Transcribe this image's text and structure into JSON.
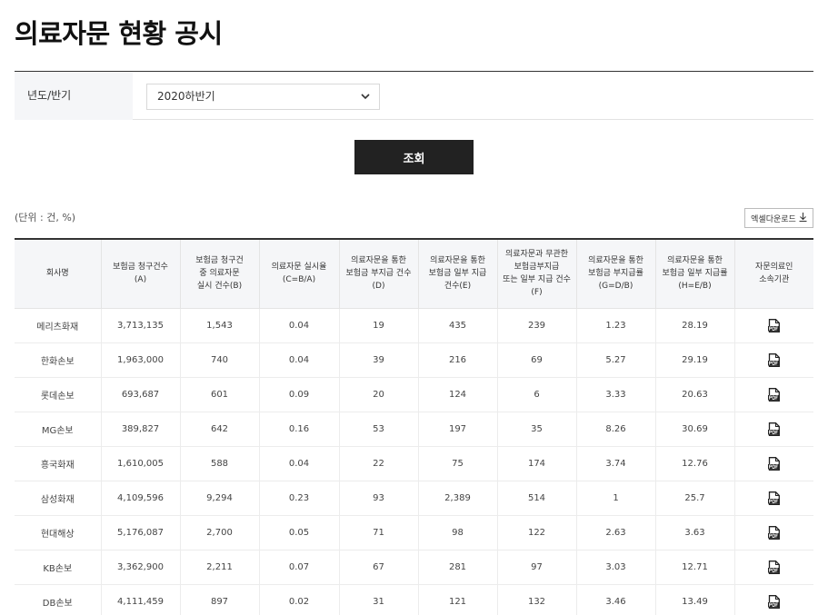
{
  "page": {
    "title": "의료자문 현황 공시"
  },
  "filter": {
    "label": "년도/반기",
    "selected": "2020하반기"
  },
  "search_label": "조회",
  "unit_text": "(단위 : 건, %)",
  "excel_label": "엑셀다운로드",
  "table": {
    "headers": [
      "회사명",
      "보험금 청구건수\n(A)",
      "보험금 청구건\n중 의료자문\n실시 건수(B)",
      "의료자문 실시율\n(C=B/A)",
      "의료자문을 통한\n보험금 부지급 건수\n(D)",
      "의료자문을 통한\n보험금 일부 지급\n건수(E)",
      "의료자문과 무관한\n보험금부지급\n또는 일부 지급 건수\n(F)",
      "의료자문을 통한\n보험금 부지급률\n(G=D/B)",
      "의료자문을 통한\n보험금 일부 지급률\n(H=E/B)",
      "자문의료인\n소속기관"
    ],
    "rows": [
      [
        "메리츠화재",
        "3,713,135",
        "1,543",
        "0.04",
        "19",
        "435",
        "239",
        "1.23",
        "28.19"
      ],
      [
        "한화손보",
        "1,963,000",
        "740",
        "0.04",
        "39",
        "216",
        "69",
        "5.27",
        "29.19"
      ],
      [
        "롯데손보",
        "693,687",
        "601",
        "0.09",
        "20",
        "124",
        "6",
        "3.33",
        "20.63"
      ],
      [
        "MG손보",
        "389,827",
        "642",
        "0.16",
        "53",
        "197",
        "35",
        "8.26",
        "30.69"
      ],
      [
        "흥국화재",
        "1,610,005",
        "588",
        "0.04",
        "22",
        "75",
        "174",
        "3.74",
        "12.76"
      ],
      [
        "삼성화재",
        "4,109,596",
        "9,294",
        "0.23",
        "93",
        "2,389",
        "514",
        "1",
        "25.7"
      ],
      [
        "현대해상",
        "5,176,087",
        "2,700",
        "0.05",
        "71",
        "98",
        "122",
        "2.63",
        "3.63"
      ],
      [
        "KB손보",
        "3,362,900",
        "2,211",
        "0.07",
        "67",
        "281",
        "97",
        "3.03",
        "12.71"
      ],
      [
        "DB손보",
        "4,111,459",
        "897",
        "0.02",
        "31",
        "121",
        "132",
        "3.46",
        "13.49"
      ]
    ]
  },
  "icons": {
    "dropdown": "chevron-down-icon",
    "download": "download-arrow-icon",
    "file": "pdf-file-icon"
  }
}
